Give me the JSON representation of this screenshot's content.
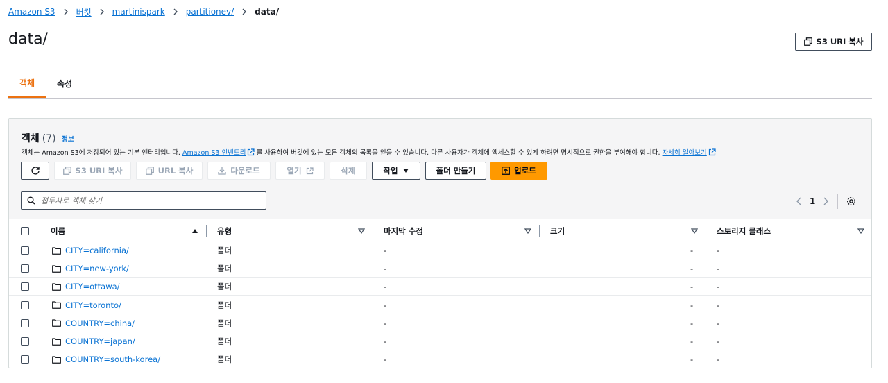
{
  "breadcrumb": [
    "Amazon S3",
    "버킷",
    "martinispark",
    "partitionev/",
    "data/"
  ],
  "page_title": "data/",
  "copy_s3_uri_top": "S3 URI 복사",
  "tabs": [
    {
      "label": "객체",
      "active": true
    },
    {
      "label": "속성",
      "active": false
    }
  ],
  "panel": {
    "title": "객체",
    "count": "(7)",
    "info": "정보",
    "desc_before": "객체는 Amazon S3에 저장되어 있는 기본 엔터티입니다.",
    "desc_link1": "Amazon S3 인벤토리",
    "desc_middle": "를 사용하여 버킷에 있는 모든 객체의 목록을 얻을 수 있습니다. 다른 사용자가 객체에 액세스할 수 있게 하려면 명시적으로 권한을 부여해야 합니다.",
    "desc_link2": "자세히 알아보기"
  },
  "toolbar": {
    "copy_s3_uri": "S3 URI 복사",
    "copy_url": "URL 복사",
    "download": "다운로드",
    "open": "열기",
    "delete": "삭제",
    "actions": "작업",
    "create_folder": "폴더 만들기",
    "upload": "업로드"
  },
  "search": {
    "placeholder": "접두사로 객체 찾기"
  },
  "pager": {
    "page": "1"
  },
  "columns": [
    "이름",
    "유형",
    "마지막 수정",
    "크기",
    "스토리지 클래스"
  ],
  "rows": [
    {
      "name": "CITY=california/",
      "type": "폴더",
      "modified": "-",
      "size": "-",
      "storage": "-"
    },
    {
      "name": "CITY=new-york/",
      "type": "폴더",
      "modified": "-",
      "size": "-",
      "storage": "-"
    },
    {
      "name": "CITY=ottawa/",
      "type": "폴더",
      "modified": "-",
      "size": "-",
      "storage": "-"
    },
    {
      "name": "CITY=toronto/",
      "type": "폴더",
      "modified": "-",
      "size": "-",
      "storage": "-"
    },
    {
      "name": "COUNTRY=china/",
      "type": "폴더",
      "modified": "-",
      "size": "-",
      "storage": "-"
    },
    {
      "name": "COUNTRY=japan/",
      "type": "폴더",
      "modified": "-",
      "size": "-",
      "storage": "-"
    },
    {
      "name": "COUNTRY=south-korea/",
      "type": "폴더",
      "modified": "-",
      "size": "-",
      "storage": "-"
    }
  ],
  "colors": {
    "link": "#0972d3",
    "accent": "#ec7211",
    "primary": "#ff9900"
  }
}
